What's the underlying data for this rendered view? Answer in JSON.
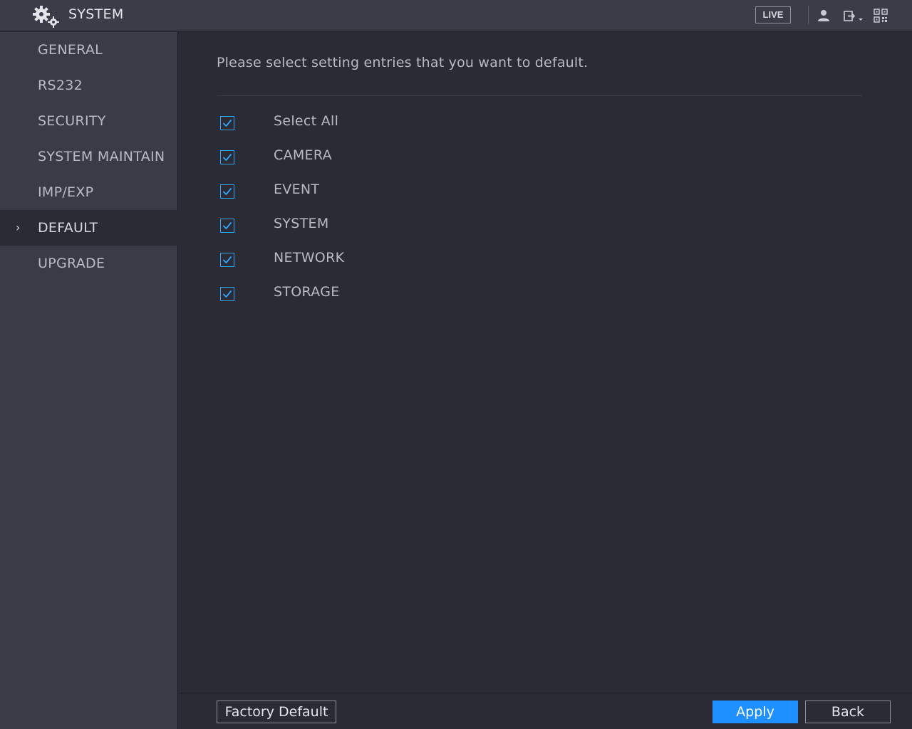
{
  "topbar": {
    "title": "SYSTEM",
    "live_label": "LIVE",
    "icons": [
      "gear-icon",
      "user-icon",
      "logout-icon",
      "qr-code-icon"
    ]
  },
  "sidebar": {
    "items": [
      {
        "label": "GENERAL"
      },
      {
        "label": "RS232"
      },
      {
        "label": "SECURITY"
      },
      {
        "label": "SYSTEM MAINTAIN"
      },
      {
        "label": "IMP/EXP"
      },
      {
        "label": "DEFAULT",
        "active": true
      },
      {
        "label": "UPGRADE"
      }
    ]
  },
  "main": {
    "prompt": "Please select setting entries that you want to default.",
    "checkboxes": [
      {
        "label": "Select All",
        "checked": true
      },
      {
        "label": "CAMERA",
        "checked": true
      },
      {
        "label": "EVENT",
        "checked": true
      },
      {
        "label": "SYSTEM",
        "checked": true
      },
      {
        "label": "NETWORK",
        "checked": true
      },
      {
        "label": "STORAGE",
        "checked": true
      }
    ]
  },
  "footer": {
    "factory_default_label": "Factory Default",
    "apply_label": "Apply",
    "back_label": "Back"
  },
  "colors": {
    "accent": "#1e90ff",
    "checkbox": "#2ea6ff",
    "background": "#2a2b34",
    "sidebar": "#3a3b46"
  }
}
